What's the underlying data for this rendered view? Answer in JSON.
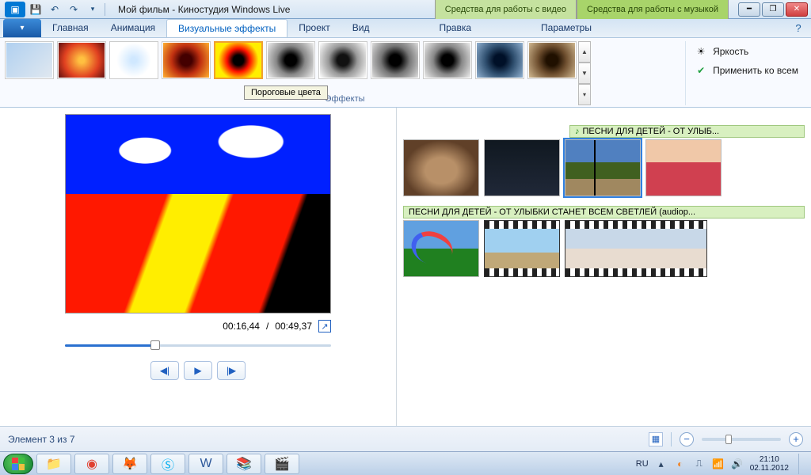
{
  "titlebar": {
    "app_title": "Мой фильм - Киностудия Windows Live",
    "ctx_video": "Средства для работы с видео",
    "ctx_music": "Средства для работы с музыкой"
  },
  "tabs": {
    "home": "Главная",
    "animation": "Анимация",
    "visual_fx": "Визуальные эффекты",
    "project": "Проект",
    "view": "Вид",
    "edit": "Правка",
    "params": "Параметры"
  },
  "ribbon": {
    "group_label": "Эффекты",
    "brightness": "Яркость",
    "apply_all": "Применить ко всем",
    "tooltip": "Пороговые цвета"
  },
  "preview": {
    "time_current": "00:16,44",
    "time_total": "00:49,37"
  },
  "storyboard": {
    "music1": "ПЕСНИ ДЛЯ ДЕТЕЙ - ОТ УЛЫБ...",
    "music2": "ПЕСНИ ДЛЯ ДЕТЕЙ - ОТ УЛЫБКИ СТАНЕТ ВСЕМ СВЕТЛЕЙ  (audiop..."
  },
  "status": {
    "text": "Элемент 3 из 7"
  },
  "tray": {
    "lang": "RU",
    "time": "21:10",
    "date": "02.11.2012"
  }
}
